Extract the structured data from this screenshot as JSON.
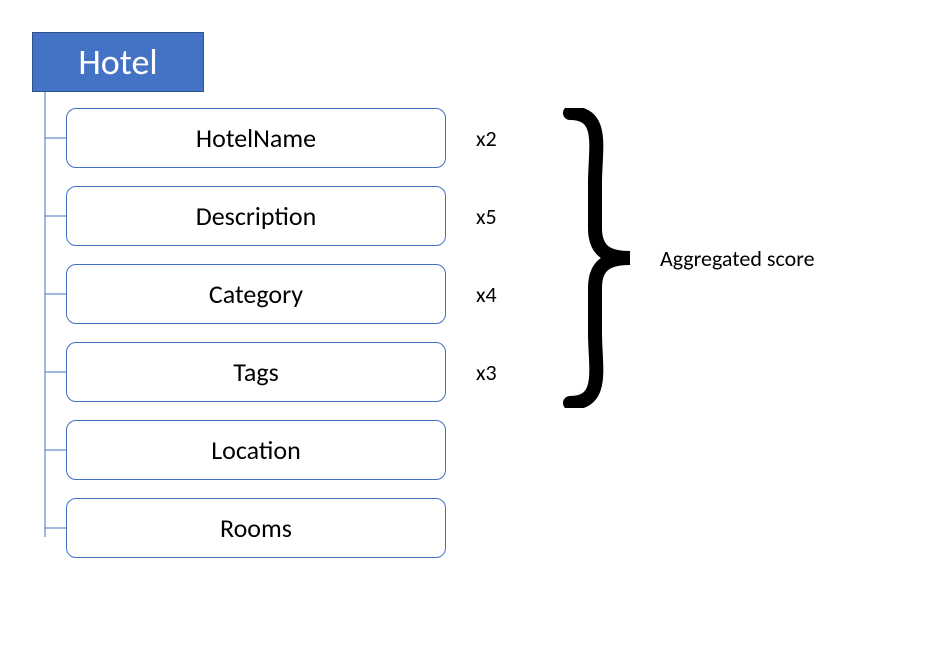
{
  "root": {
    "label": "Hotel"
  },
  "children": [
    {
      "label": "HotelName",
      "multiplier": "x2"
    },
    {
      "label": "Description",
      "multiplier": "x5"
    },
    {
      "label": "Category",
      "multiplier": "x4"
    },
    {
      "label": "Tags",
      "multiplier": "x3"
    },
    {
      "label": "Location",
      "multiplier": ""
    },
    {
      "label": "Rooms",
      "multiplier": ""
    }
  ],
  "aggregated": {
    "label": "Aggregated score"
  },
  "colors": {
    "root_bg": "#4472C4",
    "root_border": "#2F528F",
    "node_border": "#4472C4"
  }
}
